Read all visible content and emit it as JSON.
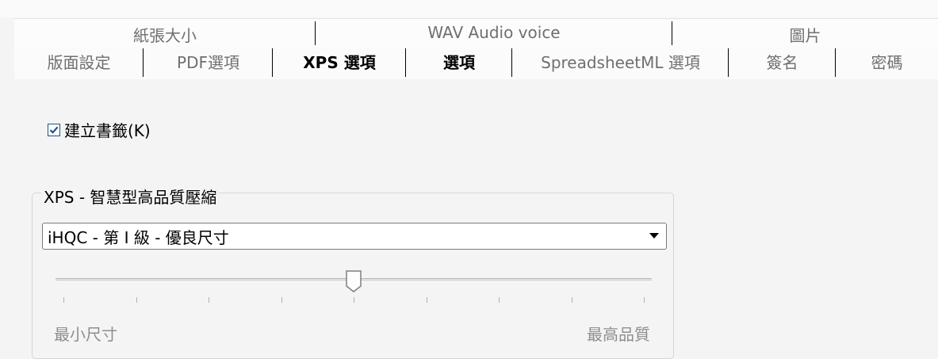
{
  "tabs": {
    "back_row": [
      "紙張大小",
      "WAV Audio voice",
      "圖片"
    ],
    "front_row": [
      "版面設定",
      "PDF選項",
      "XPS 選項",
      "選項",
      "SpreadsheetML 選項",
      "簽名",
      "密碼"
    ],
    "selected": "XPS 選項"
  },
  "bookmark_checkbox": {
    "label": "建立書籤(K)",
    "checked": true
  },
  "compression": {
    "group_title": "XPS - 智慧型高品質壓縮",
    "selected_option": "iHQC - 第 I 級 - 優良尺寸",
    "slider": {
      "position_fraction": 0.5,
      "tick_count": 9
    },
    "min_label": "最小尺寸",
    "max_label": "最高品質"
  },
  "colors": {
    "background": "#f4f4f4",
    "checkbox_border": "#1c5180",
    "check_mark": "#2a4f8c"
  }
}
